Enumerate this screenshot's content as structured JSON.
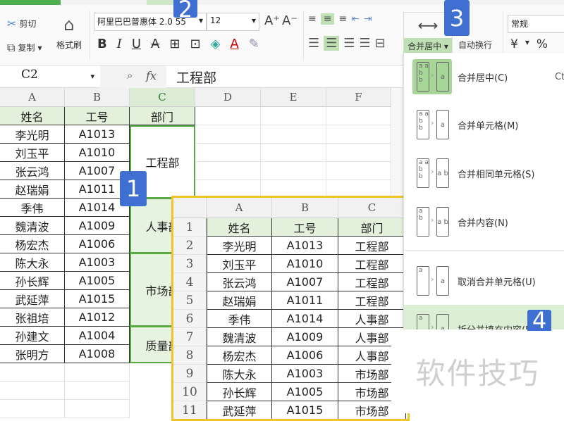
{
  "ribbon": {
    "cut": "剪切",
    "copy": "复制",
    "format_painter": "格式刷",
    "font_name": "阿里巴巴普惠体 2.0 55",
    "font_size": "12",
    "merge_center": "合并居中",
    "wrap_text": "自动换行",
    "number_format": "常规",
    "currency": "¥",
    "percent": "%"
  },
  "formula_bar": {
    "cell_ref": "C2",
    "fx": "fx",
    "value": "工程部"
  },
  "columns": [
    "A",
    "B",
    "C",
    "D",
    "E",
    "F"
  ],
  "sheet": {
    "headers": [
      "姓名",
      "工号",
      "部门"
    ],
    "rows": [
      [
        "李光明",
        "A1013"
      ],
      [
        "刘玉平",
        "A1010"
      ],
      [
        "张云鸿",
        "A1007"
      ],
      [
        "赵瑞娟",
        "A1011"
      ],
      [
        "季伟",
        "A1014"
      ],
      [
        "魏清波",
        "A1009"
      ],
      [
        "杨宏杰",
        "A1006"
      ],
      [
        "陈大永",
        "A1003"
      ],
      [
        "孙长辉",
        "A1005"
      ],
      [
        "武延萍",
        "A1015"
      ],
      [
        "张祖培",
        "A1012"
      ],
      [
        "孙建文",
        "A1004"
      ],
      [
        "张明方",
        "A1008"
      ]
    ],
    "merged": [
      {
        "label": "工程部",
        "span": 4
      },
      {
        "label": "人事部",
        "span": 3
      },
      {
        "label": "市场部",
        "span": 4
      },
      {
        "label": "质量部",
        "span": 2
      }
    ]
  },
  "inset": {
    "columns": [
      "A",
      "B",
      "C"
    ],
    "row_numbers": [
      "1",
      "2",
      "3",
      "4",
      "5",
      "6",
      "7",
      "8",
      "9",
      "10",
      "11"
    ],
    "rows": [
      [
        "姓名",
        "工号",
        "部门"
      ],
      [
        "李光明",
        "A1013",
        "工程部"
      ],
      [
        "刘玉平",
        "A1010",
        "工程部"
      ],
      [
        "张云鸿",
        "A1007",
        "工程部"
      ],
      [
        "赵瑞娟",
        "A1011",
        "工程部"
      ],
      [
        "季伟",
        "A1014",
        "人事部"
      ],
      [
        "魏清波",
        "A1009",
        "人事部"
      ],
      [
        "杨宏杰",
        "A1006",
        "人事部"
      ],
      [
        "陈大永",
        "A1003",
        "市场部"
      ],
      [
        "孙长辉",
        "A1005",
        "市场部"
      ],
      [
        "武延萍",
        "A1015",
        "市场部"
      ]
    ]
  },
  "menu": {
    "items": [
      {
        "label": "合并居中(C)",
        "shortcut": "Ct"
      },
      {
        "label": "合并单元格(M)"
      },
      {
        "label": "合并相同单元格(S)"
      },
      {
        "label": "合并内容(N)"
      },
      {
        "label": "取消合并单元格(U)"
      },
      {
        "label": "拆分并填充内容(F)"
      }
    ]
  },
  "badges": [
    "1",
    "2",
    "3",
    "4"
  ],
  "watermark": "软件技巧"
}
